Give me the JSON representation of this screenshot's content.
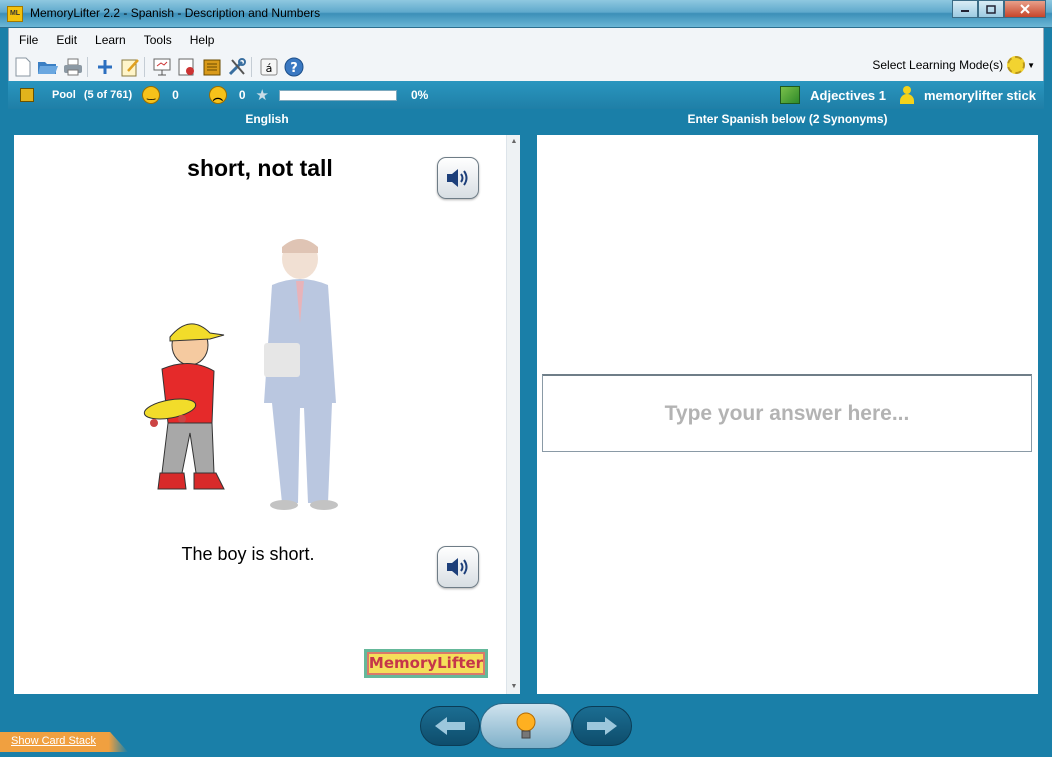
{
  "window": {
    "title": "MemoryLifter 2.2 - Spanish - Description and Numbers",
    "app_icon_text": "ML",
    "minimize_icon": "minimize-icon",
    "maximize_icon": "maximize-icon",
    "close_icon": "close-icon"
  },
  "menu": {
    "items": [
      "File",
      "Edit",
      "Learn",
      "Tools",
      "Help"
    ]
  },
  "toolbar": {
    "mode_label": "Select Learning Mode(s)"
  },
  "status": {
    "pool_label": "Pool",
    "pool_count": "(5 of 761)",
    "correct_score": "0",
    "wrong_score": "0",
    "progress_percent": "0%",
    "progress_value": 0,
    "chapter": "Adjectives 1",
    "user": "memorylifter stick"
  },
  "columns": {
    "left_header": "English",
    "right_header": "Enter Spanish below (2 Synonyms)"
  },
  "card": {
    "question": "short, not tall",
    "example": "The boy is short.",
    "logo_text": "MemoryLifter"
  },
  "answer": {
    "placeholder": "Type your answer here...",
    "value": ""
  },
  "bottom": {
    "show_card_stack": "Show Card Stack"
  },
  "colors": {
    "window_bg": "#1a7fa8",
    "status_bar": "#2a96bf",
    "progress_fill": "#4fb24f",
    "placeholder": "#b3b3b3"
  }
}
